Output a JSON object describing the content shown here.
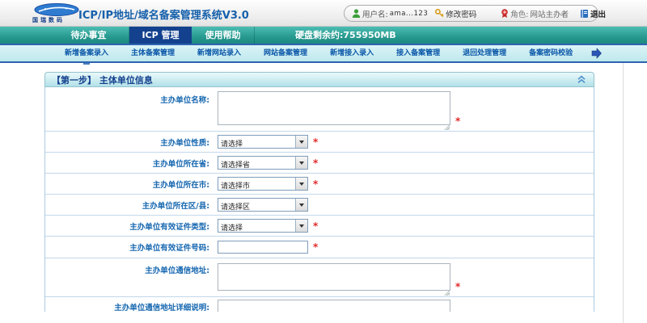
{
  "header": {
    "brand": "国瑞数码",
    "title": "ICP/IP地址/域名备案管理系统V3.0",
    "user_bar": {
      "username_label": "用户名:",
      "username_value": "ama...123",
      "change_password": "修改密码",
      "role_label": "角色:",
      "role_value": "网站主办者",
      "logout": "退出"
    }
  },
  "nav": {
    "tabs": [
      {
        "label": "待办事宜",
        "active": false
      },
      {
        "label": "ICP 管理",
        "active": true
      },
      {
        "label": "使用帮助",
        "active": false
      }
    ],
    "disk_info": "硬盘剩余约:755950MB"
  },
  "subnav": {
    "items": [
      "新增备案录入",
      "主体备案管理",
      "新增网站录入",
      "网站备案管理",
      "新增接入录入",
      "接入备案管理",
      "退回处理管理",
      "备案密码校验"
    ]
  },
  "form": {
    "section_title": "【第一步】 主体单位信息",
    "required_marker": "*",
    "rows": [
      {
        "name": "org-name",
        "label": "主办单位名称:",
        "type": "textarea_lg",
        "value": "",
        "required": true
      },
      {
        "name": "org-nature",
        "label": "主办单位性质:",
        "type": "select",
        "value": "请选择",
        "required": true
      },
      {
        "name": "org-province",
        "label": "主办单位所在省:",
        "type": "select",
        "value": "请选择省",
        "required": true
      },
      {
        "name": "org-city",
        "label": "主办单位所在市:",
        "type": "select",
        "value": "请选择市",
        "required": true
      },
      {
        "name": "org-district",
        "label": "主办单位所在区/县:",
        "type": "select",
        "value": "请选择区",
        "required": false
      },
      {
        "name": "org-cert-type",
        "label": "主办单位有效证件类型:",
        "type": "select",
        "value": "请选择",
        "required": true
      },
      {
        "name": "org-cert-number",
        "label": "主办单位有效证件号码:",
        "type": "input",
        "value": "",
        "required": true
      },
      {
        "name": "org-address",
        "label": "主办单位通信地址:",
        "type": "textarea_sm",
        "value": "",
        "required": true
      },
      {
        "name": "org-address-note",
        "label": "主办单位通信地址详细说明:",
        "type": "textarea_partial",
        "value": "",
        "required": false
      }
    ]
  },
  "colors": {
    "accent_teal": "#27998F",
    "active_tab_navy": "#13418D",
    "link_blue": "#0A56A8",
    "label_blue": "#1667B0",
    "required_red": "#E02A2A",
    "subnav_cyan": "#BEE8ED"
  }
}
